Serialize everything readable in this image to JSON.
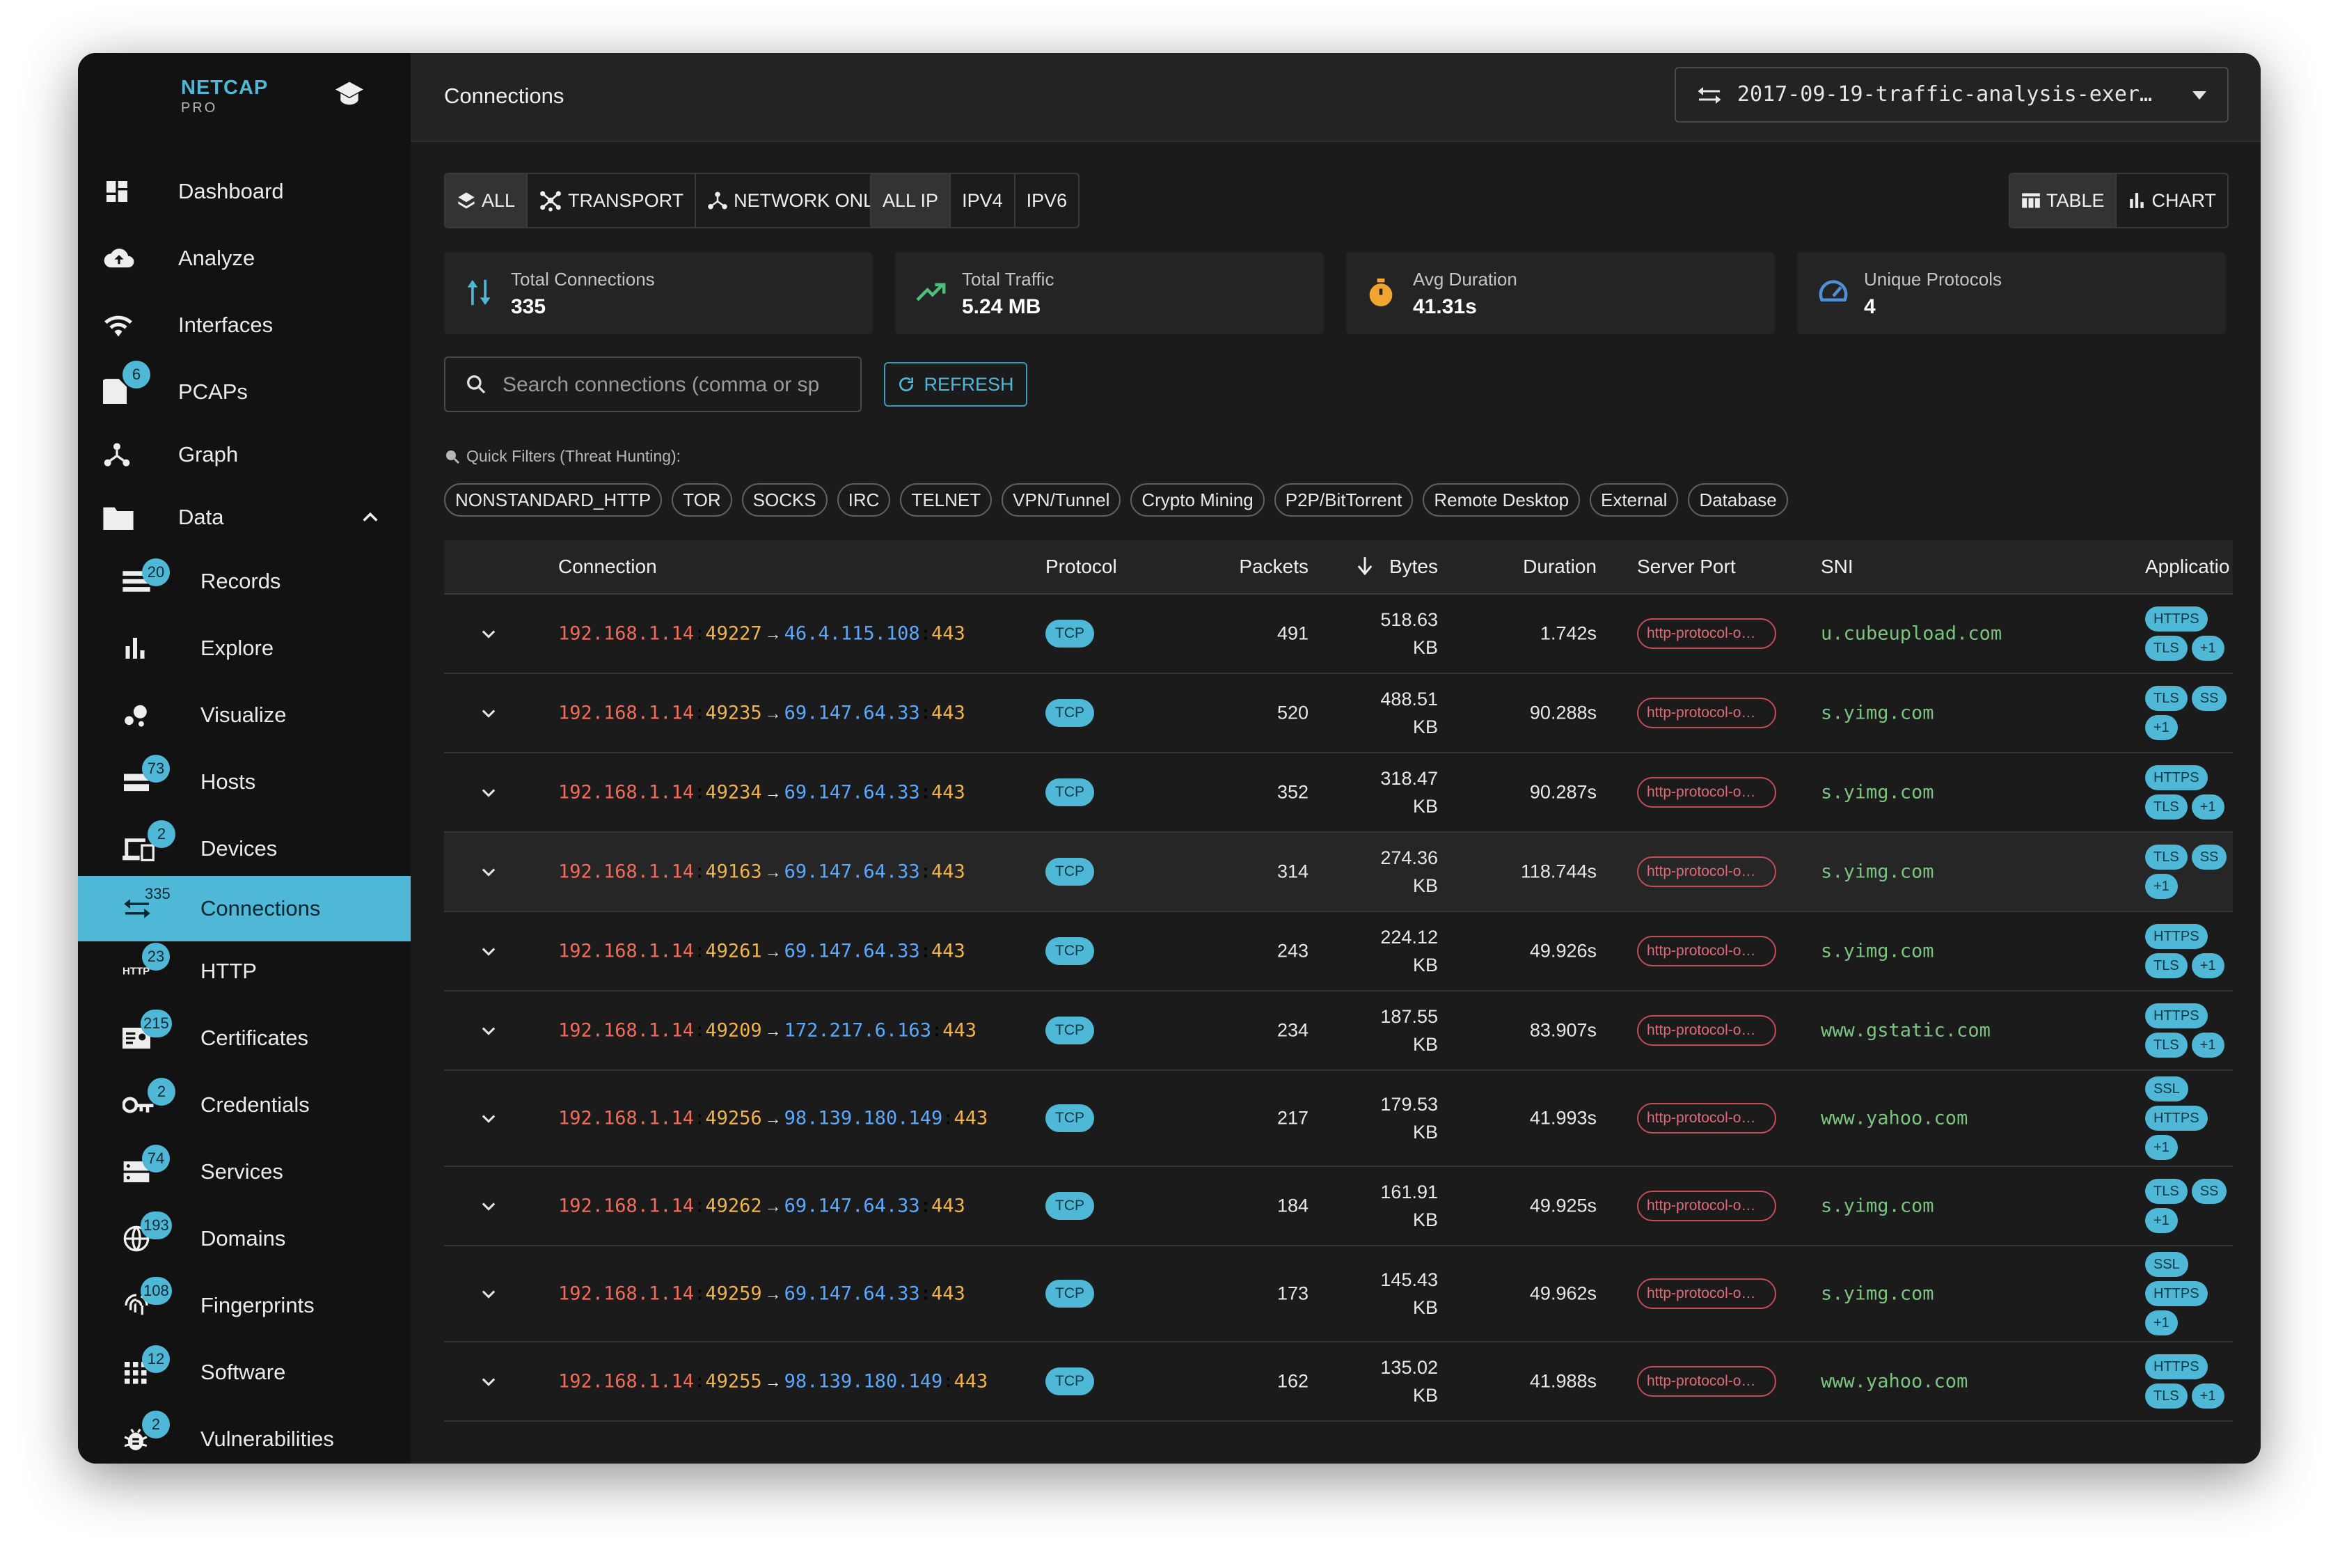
{
  "brand": {
    "name": "NETCAP",
    "edition": "PRO"
  },
  "nav": {
    "dashboard": "Dashboard",
    "analyze": "Analyze",
    "interfaces": "Interfaces",
    "pcaps": "PCAPs",
    "pcaps_badge": "6",
    "graph": "Graph",
    "data": "Data",
    "records": "Records",
    "records_badge": "20",
    "explore": "Explore",
    "visualize": "Visualize",
    "hosts": "Hosts",
    "hosts_badge": "73",
    "devices": "Devices",
    "devices_badge": "2",
    "connections": "Connections",
    "connections_badge": "335",
    "http": "HTTP",
    "http_badge": "23",
    "http_icon_text": "HTTP",
    "certificates": "Certificates",
    "certificates_badge": "215",
    "credentials": "Credentials",
    "credentials_badge": "2",
    "services": "Services",
    "services_badge": "74",
    "domains": "Domains",
    "domains_badge": "193",
    "fingerprints": "Fingerprints",
    "fingerprints_badge": "108",
    "software": "Software",
    "software_badge": "12",
    "vulnerabilities": "Vulnerabilities",
    "vulnerabilities_badge": "2"
  },
  "header": {
    "title": "Connections",
    "file": "2017-09-19-traffic-analysis-exer…"
  },
  "filters": {
    "layer": [
      "ALL",
      "TRANSPORT",
      "NETWORK ONLY"
    ],
    "ip": [
      "ALL IP",
      "IPV4",
      "IPV6"
    ],
    "view": [
      "TABLE",
      "CHART"
    ]
  },
  "stats": {
    "total_connections_label": "Total Connections",
    "total_connections": "335",
    "total_traffic_label": "Total Traffic",
    "total_traffic": "5.24 MB",
    "avg_duration_label": "Avg Duration",
    "avg_duration": "41.31s",
    "unique_protocols_label": "Unique Protocols",
    "unique_protocols": "4"
  },
  "search": {
    "placeholder": "Search connections (comma or sp"
  },
  "refresh_label": "REFRESH",
  "quick_filters": {
    "label": "Quick Filters (Threat Hunting):",
    "items": [
      "NONSTANDARD_HTTP",
      "TOR",
      "SOCKS",
      "IRC",
      "TELNET",
      "VPN/Tunnel",
      "Crypto Mining",
      "P2P/BitTorrent",
      "Remote Desktop",
      "External",
      "Database"
    ]
  },
  "table": {
    "columns": {
      "connection": "Connection",
      "protocol": "Protocol",
      "packets": "Packets",
      "bytes": "Bytes",
      "duration": "Duration",
      "server_port": "Server Port",
      "sni": "SNI",
      "application": "Applicatio"
    },
    "rows": [
      {
        "src_ip": "192.168.1.14",
        "src_port": "49227",
        "dst_ip": "46.4.115.108",
        "dst_port": "443",
        "arrow": "→",
        "protocol": "TCP",
        "packets": "491",
        "bytes_val": "518.63",
        "bytes_unit": "KB",
        "duration": "1.742s",
        "server_port": "http-protocol-o…",
        "sni": "u.cubeupload.com",
        "apps": [
          "HTTPS",
          "TLS",
          "+1"
        ]
      },
      {
        "src_ip": "192.168.1.14",
        "src_port": "49235",
        "dst_ip": "69.147.64.33",
        "dst_port": "443",
        "arrow": "→",
        "protocol": "TCP",
        "packets": "520",
        "bytes_val": "488.51",
        "bytes_unit": "KB",
        "duration": "90.288s",
        "server_port": "http-protocol-o…",
        "sni": "s.yimg.com",
        "apps": [
          "TLS",
          "SS",
          "+1"
        ]
      },
      {
        "src_ip": "192.168.1.14",
        "src_port": "49234",
        "dst_ip": "69.147.64.33",
        "dst_port": "443",
        "arrow": "→",
        "protocol": "TCP",
        "packets": "352",
        "bytes_val": "318.47",
        "bytes_unit": "KB",
        "duration": "90.287s",
        "server_port": "http-protocol-o…",
        "sni": "s.yimg.com",
        "apps": [
          "HTTPS",
          "TLS",
          "+1"
        ]
      },
      {
        "src_ip": "192.168.1.14",
        "src_port": "49163",
        "dst_ip": "69.147.64.33",
        "dst_port": "443",
        "arrow": "→",
        "protocol": "TCP",
        "packets": "314",
        "bytes_val": "274.36",
        "bytes_unit": "KB",
        "duration": "118.744s",
        "server_port": "http-protocol-o…",
        "sni": "s.yimg.com",
        "apps": [
          "TLS",
          "SS",
          "+1"
        ]
      },
      {
        "src_ip": "192.168.1.14",
        "src_port": "49261",
        "dst_ip": "69.147.64.33",
        "dst_port": "443",
        "arrow": "→",
        "protocol": "TCP",
        "packets": "243",
        "bytes_val": "224.12",
        "bytes_unit": "KB",
        "duration": "49.926s",
        "server_port": "http-protocol-o…",
        "sni": "s.yimg.com",
        "apps": [
          "HTTPS",
          "TLS",
          "+1"
        ]
      },
      {
        "src_ip": "192.168.1.14",
        "src_port": "49209",
        "dst_ip": "172.217.6.163",
        "dst_port": "443",
        "arrow": "→",
        "protocol": "TCP",
        "packets": "234",
        "bytes_val": "187.55",
        "bytes_unit": "KB",
        "duration": "83.907s",
        "server_port": "http-protocol-o…",
        "sni": "www.gstatic.com",
        "apps": [
          "HTTPS",
          "TLS",
          "+1"
        ]
      },
      {
        "src_ip": "192.168.1.14",
        "src_port": "49256",
        "dst_ip": "98.139.180.149",
        "dst_port": "443",
        "arrow": "→",
        "protocol": "TCP",
        "packets": "217",
        "bytes_val": "179.53",
        "bytes_unit": "KB",
        "duration": "41.993s",
        "server_port": "http-protocol-o…",
        "sni": "www.yahoo.com",
        "apps": [
          "SSL",
          "HTTPS",
          "+1"
        ]
      },
      {
        "src_ip": "192.168.1.14",
        "src_port": "49262",
        "dst_ip": "69.147.64.33",
        "dst_port": "443",
        "arrow": "→",
        "protocol": "TCP",
        "packets": "184",
        "bytes_val": "161.91",
        "bytes_unit": "KB",
        "duration": "49.925s",
        "server_port": "http-protocol-o…",
        "sni": "s.yimg.com",
        "apps": [
          "TLS",
          "SS",
          "+1"
        ]
      },
      {
        "src_ip": "192.168.1.14",
        "src_port": "49259",
        "dst_ip": "69.147.64.33",
        "dst_port": "443",
        "arrow": "→",
        "protocol": "TCP",
        "packets": "173",
        "bytes_val": "145.43",
        "bytes_unit": "KB",
        "duration": "49.962s",
        "server_port": "http-protocol-o…",
        "sni": "s.yimg.com",
        "apps": [
          "SSL",
          "HTTPS",
          "+1"
        ]
      },
      {
        "src_ip": "192.168.1.14",
        "src_port": "49255",
        "dst_ip": "98.139.180.149",
        "dst_port": "443",
        "arrow": "→",
        "protocol": "TCP",
        "packets": "162",
        "bytes_val": "135.02",
        "bytes_unit": "KB",
        "duration": "41.988s",
        "server_port": "http-protocol-o…",
        "sni": "www.yahoo.com",
        "apps": [
          "HTTPS",
          "TLS",
          "+1"
        ]
      }
    ]
  },
  "colors": {
    "accent": "#4fb8d6",
    "src_ip": "#f26b5b",
    "dst_ip": "#5aa9ff",
    "port": "#f0b34c",
    "sni": "#7bc47f",
    "server_port": "#e06a78"
  }
}
